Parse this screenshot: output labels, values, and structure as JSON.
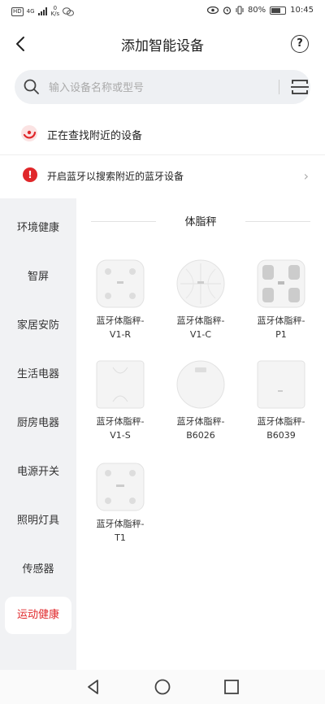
{
  "status_bar": {
    "network_badge": "HD",
    "signal_type": "4G",
    "net_speed_value": "0",
    "net_speed_unit": "K/s",
    "battery": "80%",
    "battery_level": 0.8,
    "time": "10:45"
  },
  "header": {
    "title": "添加智能设备"
  },
  "search": {
    "placeholder": "输入设备名称或型号"
  },
  "scanning": {
    "text": "正在查找附近的设备"
  },
  "bluetooth_tip": {
    "text": "开启蓝牙以搜索附近的蓝牙设备"
  },
  "sidebar": {
    "items": [
      {
        "label": "环境健康"
      },
      {
        "label": "智屏"
      },
      {
        "label": "家居安防"
      },
      {
        "label": "生活电器"
      },
      {
        "label": "厨房电器"
      },
      {
        "label": "电源开关"
      },
      {
        "label": "照明灯具"
      },
      {
        "label": "传感器"
      },
      {
        "label": "运动健康"
      }
    ],
    "active_index": 8
  },
  "section": {
    "title": "体脂秤"
  },
  "devices": [
    {
      "line1": "蓝牙体脂秤-",
      "line2": "V1-R"
    },
    {
      "line1": "蓝牙体脂秤-",
      "line2": "V1-C"
    },
    {
      "line1": "蓝牙体脂秤-",
      "line2": "P1"
    },
    {
      "line1": "蓝牙体脂秤-",
      "line2": "V1-S"
    },
    {
      "line1": "蓝牙体脂秤-",
      "line2": "B6026"
    },
    {
      "line1": "蓝牙体脂秤-",
      "line2": "B6039"
    },
    {
      "line1": "蓝牙体脂秤-",
      "line2": "T1"
    }
  ],
  "colors": {
    "accent": "#e0272a",
    "sidebar_bg": "#f1f2f4",
    "search_bg": "#eef0f3"
  }
}
